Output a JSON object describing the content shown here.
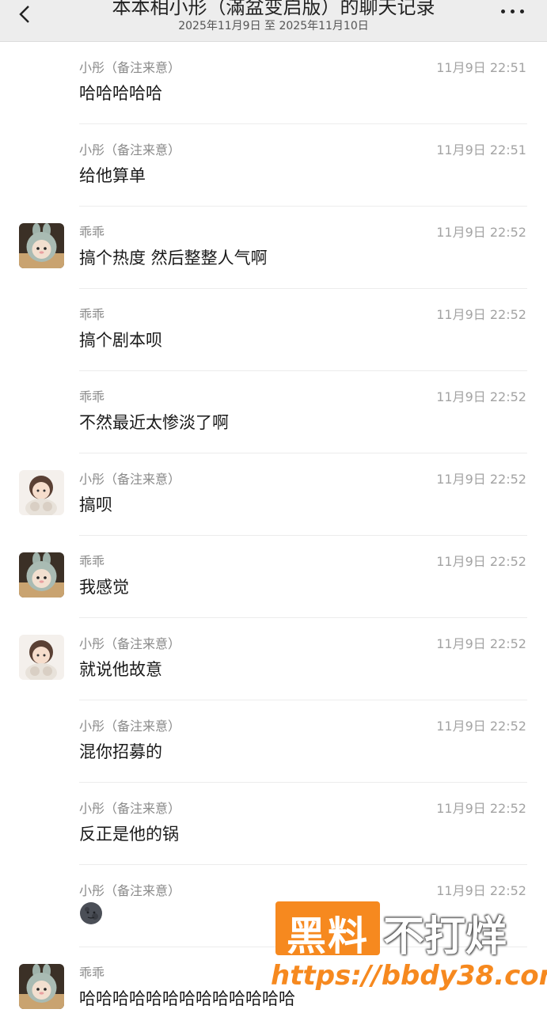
{
  "header": {
    "title": "本本相小形（滿盆变启版）的聊天记录",
    "date_range": "2025年11月9日 至 2025年11月10日"
  },
  "messages": [
    {
      "sender": "小彤（备注来意）",
      "time": "11月9日 22:51",
      "text": "哈哈哈哈哈",
      "avatar": "none"
    },
    {
      "sender": "小彤（备注来意）",
      "time": "11月9日 22:51",
      "text": "给他算单",
      "avatar": "none"
    },
    {
      "sender": "乖乖",
      "time": "11月9日 22:52",
      "text": "搞个热度 然后整整人气啊",
      "avatar": "doll"
    },
    {
      "sender": "乖乖",
      "time": "11月9日 22:52",
      "text": "搞个剧本呗",
      "avatar": "none"
    },
    {
      "sender": "乖乖",
      "time": "11月9日 22:52",
      "text": "不然最近太惨淡了啊",
      "avatar": "none"
    },
    {
      "sender": "小彤（备注来意）",
      "time": "11月9日 22:52",
      "text": "搞呗",
      "avatar": "girl"
    },
    {
      "sender": "乖乖",
      "time": "11月9日 22:52",
      "text": "我感觉",
      "avatar": "doll"
    },
    {
      "sender": "小彤（备注来意）",
      "time": "11月9日 22:52",
      "text": "就说他故意",
      "avatar": "girl"
    },
    {
      "sender": "小彤（备注来意）",
      "time": "11月9日 22:52",
      "text": "混你招募的",
      "avatar": "none"
    },
    {
      "sender": "小彤（备注来意）",
      "time": "11月9日 22:52",
      "text": "反正是他的锅",
      "avatar": "none"
    },
    {
      "sender": "小彤（备注来意）",
      "time": "11月9日 22:52",
      "text": "",
      "avatar": "none",
      "emoji": "new-moon-face-emoji"
    },
    {
      "sender": "乖乖",
      "time": "",
      "text": "哈哈哈哈哈哈哈哈哈哈哈哈哈",
      "avatar": "doll"
    }
  ],
  "watermark": {
    "box_text": "黑料",
    "side_text": "不打烊",
    "url": "https://bbdy38.com",
    "accent": "#f6891f"
  },
  "colors": {
    "header_bg": "#ededed",
    "name": "#8a8a8a",
    "time": "#a3a3a3",
    "text": "#1a1a1a"
  }
}
